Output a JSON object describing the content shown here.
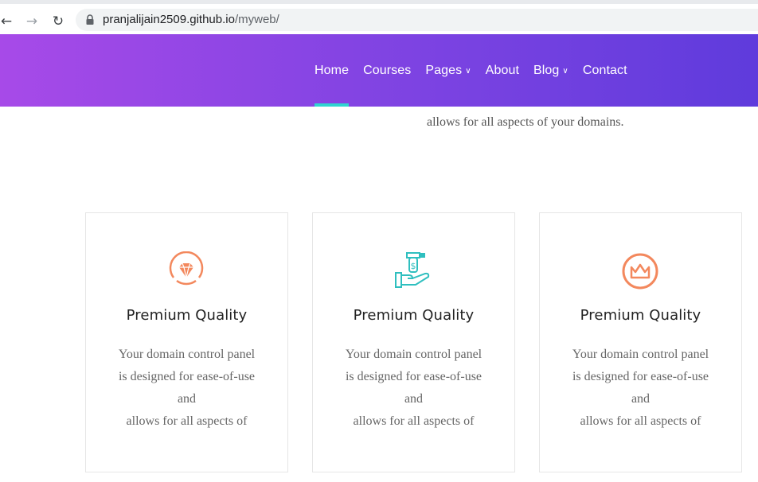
{
  "browser": {
    "url_host": "pranjalijain2509.github.io",
    "url_path": "/myweb/",
    "icons": [
      "back-arrow-icon",
      "forward-arrow-icon",
      "reload-icon",
      "lock-icon"
    ]
  },
  "header": {
    "nav": [
      {
        "label": "Home",
        "active": true
      },
      {
        "label": "Courses"
      },
      {
        "label": "Pages",
        "dropdown": true
      },
      {
        "label": "About"
      },
      {
        "label": "Blog",
        "dropdown": true
      },
      {
        "label": "Contact"
      }
    ],
    "colors": {
      "gradient_start": "#a74ae8",
      "gradient_end": "#5f3bdc",
      "active_underline": "#2fd4d0"
    }
  },
  "intro": {
    "text_line": "allows for all aspects of your domains."
  },
  "features": [
    {
      "icon": "diamond-icon",
      "icon_color": "#f3885d",
      "title": "Premium Quality",
      "lines": [
        "Your domain control panel",
        "is designed for ease-of-use",
        "and",
        "allows for all aspects of"
      ]
    },
    {
      "icon": "hand-money-icon",
      "icon_color": "#2fbfbf",
      "title": "Premium Quality",
      "lines": [
        "Your domain control panel",
        "is designed for ease-of-use",
        "and",
        "allows for all aspects of"
      ]
    },
    {
      "icon": "crown-icon",
      "icon_color": "#f3885d",
      "title": "Premium Quality",
      "lines": [
        "Your domain control panel",
        "is designed for ease-of-use",
        "and",
        "allows for all aspects of"
      ]
    }
  ]
}
